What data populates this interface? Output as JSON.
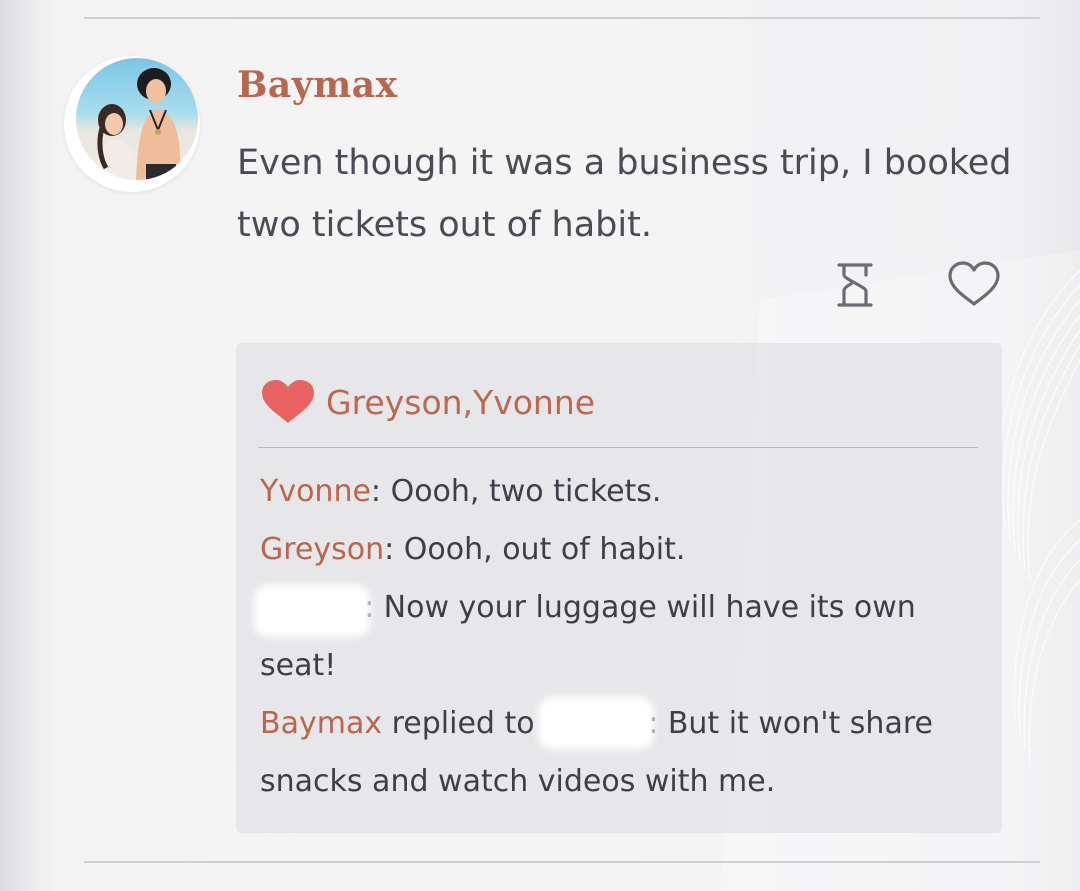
{
  "post": {
    "author": "Baymax",
    "text": "Even though it was a business trip, I booked two tickets out of habit.",
    "avatar_icon": "couple-avatar-photo",
    "actions": {
      "timer_icon": "hourglass-icon",
      "like_icon": "heart-outline-icon"
    }
  },
  "likes": {
    "icon": "heart-filled-icon",
    "names": "Greyson,Yvonne",
    "color": "#e86262"
  },
  "comments": [
    {
      "author": "Yvonne",
      "separator": ": ",
      "text": "Oooh, two tickets."
    },
    {
      "author": "Greyson",
      "separator": ": ",
      "text": "Oooh, out of habit."
    },
    {
      "author": "",
      "separator": ": ",
      "text": "Now your luggage will have its own seat!"
    },
    {
      "author": "Baymax",
      "reply_word": " replied to ",
      "reply_target": "",
      "separator": ": ",
      "text": "But it won't share snacks and watch videos with me."
    }
  ],
  "colors": {
    "name_accent": "#b86650",
    "body_text": "#4b4a55",
    "comment_box_bg": "#dedee4"
  }
}
